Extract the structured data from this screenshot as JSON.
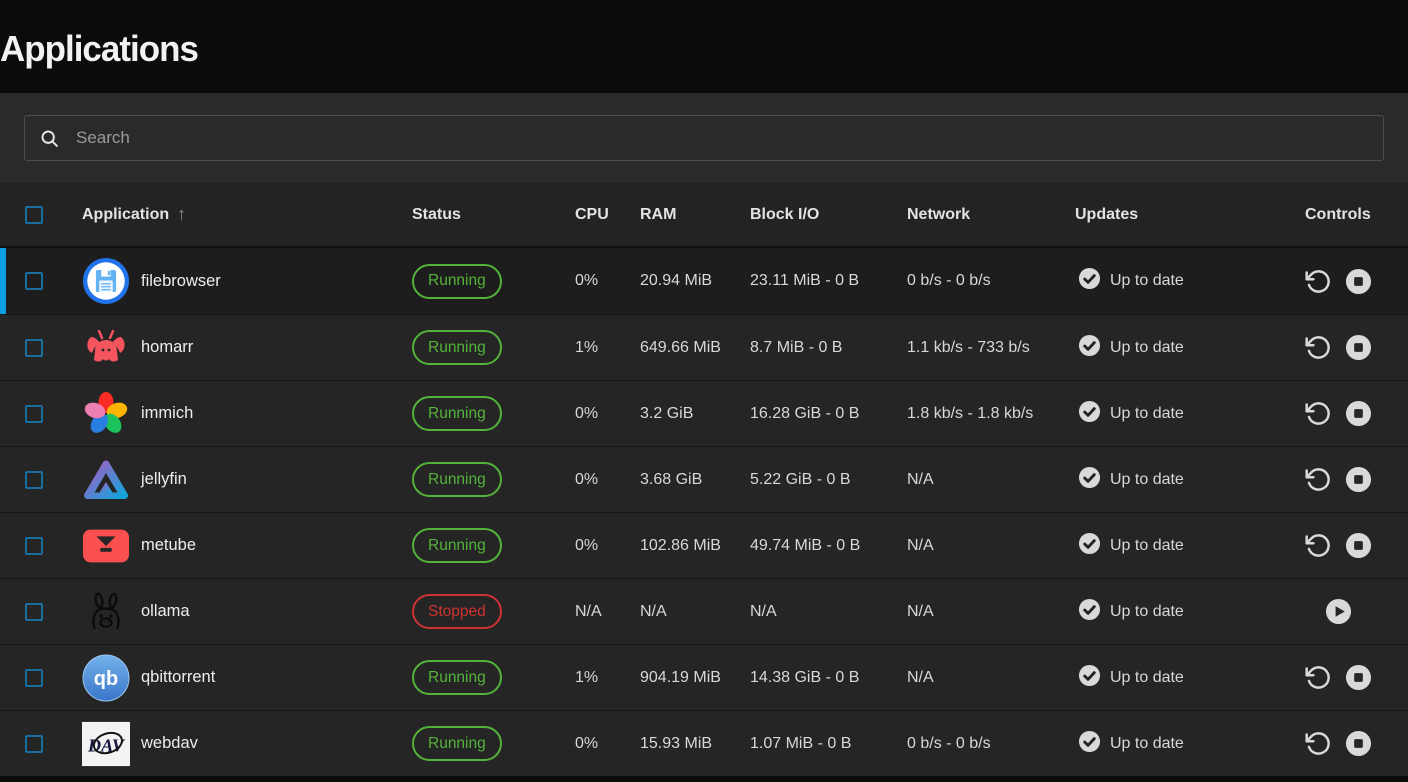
{
  "page": {
    "title": "Applications"
  },
  "search": {
    "placeholder": "Search"
  },
  "table": {
    "columns": {
      "application": "Application",
      "status": "Status",
      "cpu": "CPU",
      "ram": "RAM",
      "block_io": "Block I/O",
      "network": "Network",
      "updates": "Updates",
      "controls": "Controls"
    },
    "sort_arrow": "↑",
    "rows": [
      {
        "name": "filebrowser",
        "icon": "filebrowser",
        "status": "Running",
        "cpu": "0%",
        "ram": "20.94 MiB",
        "block_io": "23.11 MiB - 0 B",
        "network": "0 b/s - 0 b/s",
        "updates": "Up to date",
        "controls": [
          "restart",
          "stop"
        ],
        "active": true
      },
      {
        "name": "homarr",
        "icon": "homarr",
        "status": "Running",
        "cpu": "1%",
        "ram": "649.66 MiB",
        "block_io": "8.7 MiB - 0 B",
        "network": "1.1 kb/s - 733 b/s",
        "updates": "Up to date",
        "controls": [
          "restart",
          "stop"
        ],
        "active": false
      },
      {
        "name": "immich",
        "icon": "immich",
        "status": "Running",
        "cpu": "0%",
        "ram": "3.2 GiB",
        "block_io": "16.28 GiB - 0 B",
        "network": "1.8 kb/s - 1.8 kb/s",
        "updates": "Up to date",
        "controls": [
          "restart",
          "stop"
        ],
        "active": false
      },
      {
        "name": "jellyfin",
        "icon": "jellyfin",
        "status": "Running",
        "cpu": "0%",
        "ram": "3.68 GiB",
        "block_io": "5.22 GiB - 0 B",
        "network": "N/A",
        "updates": "Up to date",
        "controls": [
          "restart",
          "stop"
        ],
        "active": false
      },
      {
        "name": "metube",
        "icon": "metube",
        "status": "Running",
        "cpu": "0%",
        "ram": "102.86 MiB",
        "block_io": "49.74 MiB - 0 B",
        "network": "N/A",
        "updates": "Up to date",
        "controls": [
          "restart",
          "stop"
        ],
        "active": false
      },
      {
        "name": "ollama",
        "icon": "ollama",
        "status": "Stopped",
        "cpu": "N/A",
        "ram": "N/A",
        "block_io": "N/A",
        "network": "N/A",
        "updates": "Up to date",
        "controls": [
          "start"
        ],
        "active": false
      },
      {
        "name": "qbittorrent",
        "icon": "qbittorrent",
        "status": "Running",
        "cpu": "1%",
        "ram": "904.19 MiB",
        "block_io": "14.38 GiB - 0 B",
        "network": "N/A",
        "updates": "Up to date",
        "controls": [
          "restart",
          "stop"
        ],
        "active": false
      },
      {
        "name": "webdav",
        "icon": "webdav",
        "status": "Running",
        "cpu": "0%",
        "ram": "15.93 MiB",
        "block_io": "1.07 MiB - 0 B",
        "network": "0 b/s - 0 b/s",
        "updates": "Up to date",
        "controls": [
          "restart",
          "stop"
        ],
        "active": false
      }
    ]
  },
  "colors": {
    "accent": "#09a0e3",
    "checkbox": "#186f9d",
    "running": "#54b33b",
    "stopped": "#ce3333"
  }
}
